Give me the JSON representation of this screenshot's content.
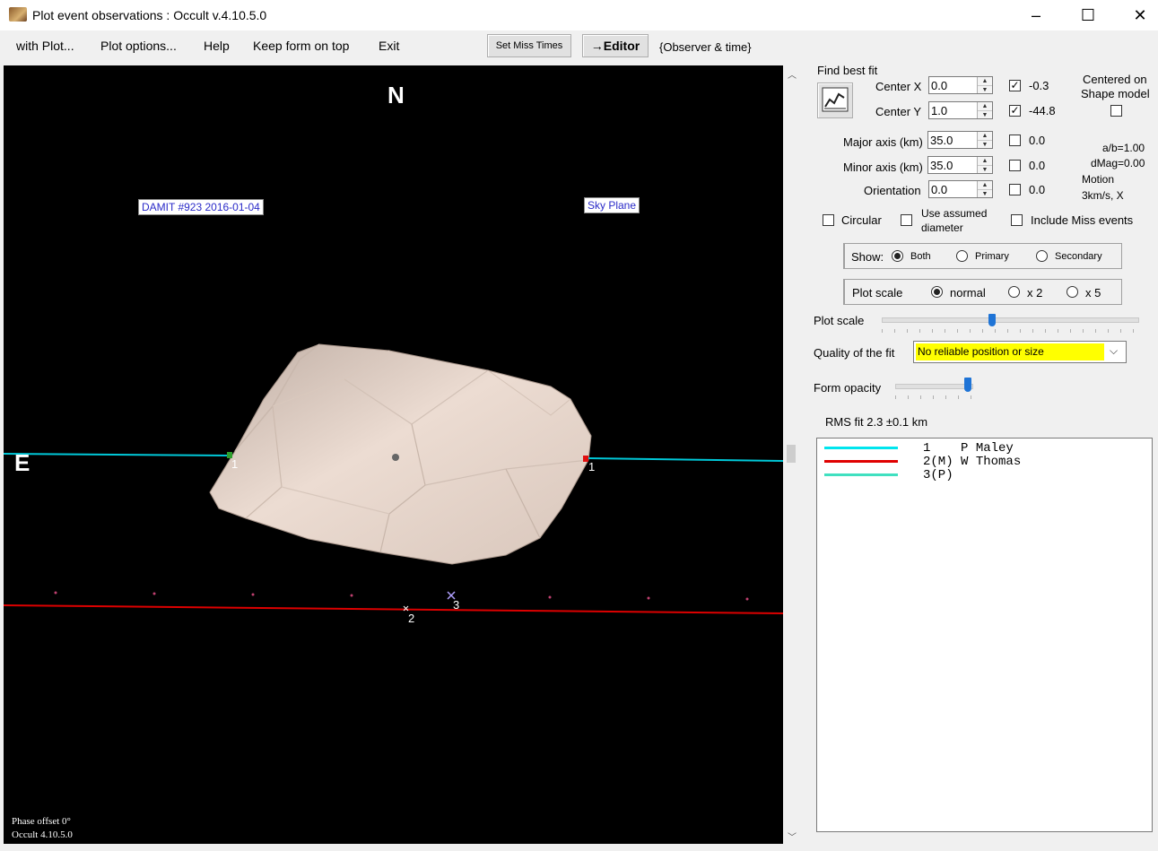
{
  "window": {
    "title": "Plot event observations : Occult v.4.10.5.0",
    "minimize": "–",
    "maximize": "☐",
    "close": "✕"
  },
  "menu": {
    "with_plot": "with Plot...",
    "plot_options": "Plot options...",
    "help": "Help",
    "keep_on_top": "Keep form on top",
    "exit": "Exit",
    "set_miss_times": "Set Miss Times",
    "editor": "→Editor",
    "observer_time": "{Observer & time}"
  },
  "plot": {
    "north": "N",
    "east": "E",
    "model_label": "DAMIT #923 2016-01-04",
    "sky_plane": "Sky Plane",
    "chord1_start": "1",
    "chord1_end": "1",
    "chord2": "2",
    "chord3": "3",
    "phase_offset": "Phase offset 0°",
    "version": "Occult 4.10.5.0"
  },
  "fit": {
    "find_best_fit": "Find best fit",
    "center_x_label": "Center X",
    "center_x_value": "0.0",
    "center_x_check": "-0.3",
    "center_y_label": "Center Y",
    "center_y_value": "1.0",
    "center_y_check": "-44.8",
    "major_label": "Major axis (km)",
    "major_value": "35.0",
    "major_check": "0.0",
    "minor_label": "Minor axis (km)",
    "minor_value": "35.0",
    "minor_check": "0.0",
    "orient_label": "Orientation",
    "orient_value": "0.0",
    "orient_check": "0.0",
    "centered_on": "Centered on",
    "shape_model": "Shape model",
    "ab": "a/b=1.00",
    "dmag": "dMag=0.00",
    "motion": "Motion",
    "motion_value": "3km/s, X",
    "circular": "Circular",
    "use_assumed_1": "Use assumed",
    "use_assumed_2": "diameter",
    "include_miss": "Include Miss events"
  },
  "show": {
    "label": "Show:",
    "both": "Both",
    "primary": "Primary",
    "secondary": "Secondary"
  },
  "scale": {
    "label": "Plot scale",
    "normal": "normal",
    "x2": "x 2",
    "x5": "x 5",
    "slider_label": "Plot scale"
  },
  "quality": {
    "label": "Quality of the fit",
    "value": "No reliable position or size"
  },
  "opacity": {
    "label": "Form opacity"
  },
  "rms": "RMS fit 2.3 ±0.1 km",
  "legend": [
    {
      "num": "1   ",
      "name": "P Maley",
      "color": "#00e5ee"
    },
    {
      "num": "2(M)",
      "name": "W Thomas",
      "color": "#e00000"
    },
    {
      "num": "3(P)",
      "name": "",
      "color": "#40e0c0"
    }
  ],
  "colors": {
    "chord1": "#00c8d8",
    "chord2": "#dd0000",
    "quality_bg": "#ffff00",
    "slider": "#1f74d6"
  }
}
